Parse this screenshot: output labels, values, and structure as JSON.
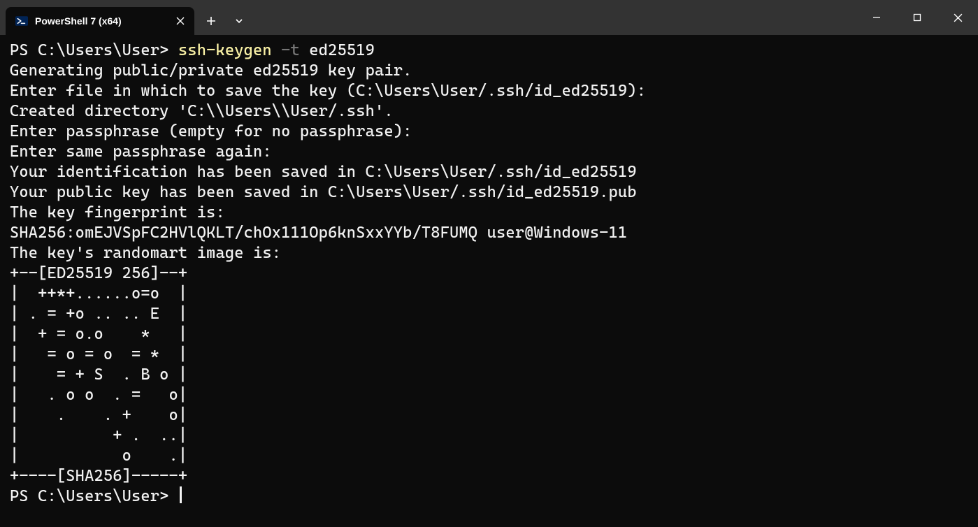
{
  "tab": {
    "title": "PowerShell 7 (x64)",
    "icon": "powershell-icon"
  },
  "terminal": {
    "prompt1_ps": "PS ",
    "prompt1_path": "C:\\Users\\User> ",
    "cmd_name": "ssh-keygen",
    "cmd_flag": " -t",
    "cmd_arg": " ed25519",
    "out_line1": "Generating public/private ed25519 key pair.",
    "out_line2": "Enter file in which to save the key (C:\\Users\\User/.ssh/id_ed25519):",
    "out_line3": "Created directory 'C:\\\\Users\\\\User/.ssh'.",
    "out_line4": "Enter passphrase (empty for no passphrase):",
    "out_line5": "Enter same passphrase again:",
    "out_line6": "Your identification has been saved in C:\\Users\\User/.ssh/id_ed25519",
    "out_line7": "Your public key has been saved in C:\\Users\\User/.ssh/id_ed25519.pub",
    "out_line8": "The key fingerprint is:",
    "out_line9": "SHA256:omEJVSpFC2HVlQKLT/chOx111Op6knSxxYYb/T8FUMQ user@Windows-11",
    "out_line10": "The key's randomart image is:",
    "art_line1": "+--[ED25519 256]--+",
    "art_line2": "|  ++*+......o=o  |",
    "art_line3": "| . = +o .. .. E  |",
    "art_line4": "|  + = o.o    *   |",
    "art_line5": "|   = o = o  = *  |",
    "art_line6": "|    = + S  . B o |",
    "art_line7": "|   . o o  . =   o|",
    "art_line8": "|    .    . +    o|",
    "art_line9": "|          + .  ..|",
    "art_line10": "|           o    .|",
    "art_line11": "+----[SHA256]-----+",
    "prompt2_ps": "PS ",
    "prompt2_path": "C:\\Users\\User> "
  }
}
